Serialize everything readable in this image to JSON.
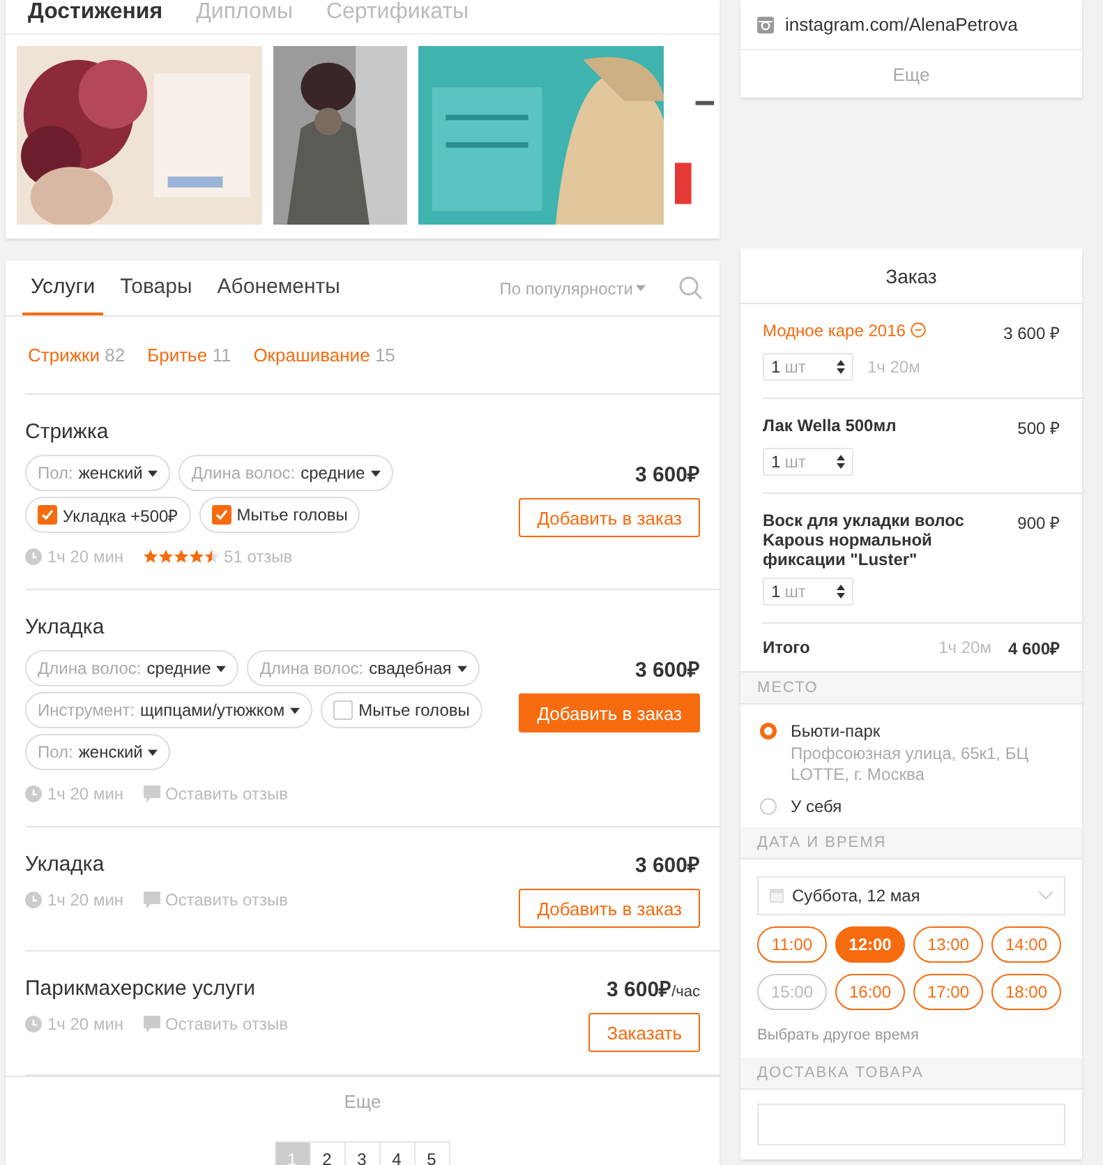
{
  "achievements": {
    "tabs": [
      {
        "label": "Достижения",
        "selected": true
      },
      {
        "label": "Дипломы",
        "selected": false
      },
      {
        "label": "Сертификаты",
        "selected": false
      }
    ]
  },
  "contacts": {
    "links": [
      {
        "text": "instagram.com/AlenaPetrova"
      }
    ],
    "more": "Еще"
  },
  "services": {
    "tabs": [
      {
        "label": "Услуги",
        "selected": true
      },
      {
        "label": "Товары",
        "selected": false
      },
      {
        "label": "Абонементы",
        "selected": false
      }
    ],
    "sort": "По популярности",
    "categories": [
      {
        "label": "Стрижки",
        "count": "82"
      },
      {
        "label": "Бритье",
        "count": "11"
      },
      {
        "label": "Окрашивание",
        "count": "15"
      }
    ],
    "items": [
      {
        "title": "Стрижка",
        "price": "3 600₽",
        "options": [
          {
            "kind": "select",
            "label": "Пол:",
            "value": "женский"
          },
          {
            "kind": "select",
            "label": "Длина волос:",
            "value": "средние"
          },
          {
            "kind": "checkbox",
            "label": "Укладка +500₽",
            "checked": true
          },
          {
            "kind": "checkbox",
            "label": "Мытье головы",
            "checked": true
          }
        ],
        "duration": "1ч 20 мин",
        "review": {
          "kind": "rating",
          "stars": 4.5,
          "text": "51 отзыв"
        },
        "button": "Добавить в заказ",
        "hovered": false
      },
      {
        "title": "Укладка",
        "price": "3 600₽",
        "options": [
          {
            "kind": "select",
            "label": "Длина волос:",
            "value": "средние"
          },
          {
            "kind": "select",
            "label": "Длина волос:",
            "value": "свадебная"
          },
          {
            "kind": "select",
            "label": "Инструмент:",
            "value": "щипцами/утюжком"
          },
          {
            "kind": "checkbox",
            "label": "Мытье головы",
            "checked": false
          },
          {
            "kind": "select",
            "label": "Пол:",
            "value": "женский"
          }
        ],
        "duration": "1ч 20 мин",
        "review": {
          "kind": "comment",
          "text": "Оставить отзыв"
        },
        "button": "Добавить в заказ",
        "hovered": true
      },
      {
        "title": "Укладка",
        "price": "3 600₽",
        "duration": "1ч 20 мин",
        "review": {
          "kind": "comment",
          "text": "Оставить отзыв"
        },
        "button": "Добавить в заказ",
        "hovered": false
      },
      {
        "title": "Парикмахерские услуги",
        "price": "3 600₽",
        "price_unit": "/час",
        "duration": "1ч 20 мин",
        "review": {
          "kind": "comment",
          "text": "Оставить отзыв"
        },
        "button": "Заказать",
        "hovered": false
      }
    ],
    "more": "Еще",
    "pages": [
      {
        "label": "1",
        "selected": true
      },
      {
        "label": "2",
        "selected": false
      },
      {
        "label": "3",
        "selected": false
      },
      {
        "label": "4",
        "selected": false
      },
      {
        "label": "5",
        "selected": false
      }
    ]
  },
  "order": {
    "title": "Заказ",
    "items": [
      {
        "kind": "service",
        "name": "Модное каре 2016",
        "price": "3 600 ₽",
        "qty": "1",
        "unit": "шт",
        "duration": "1ч 20м"
      },
      {
        "kind": "product",
        "name": "Лак Wella 500мл",
        "price": "500 ₽",
        "qty": "1",
        "unit": "шт"
      },
      {
        "kind": "product",
        "name": "Воск для укладки волос Kapous нормальной фиксации \"Luster\"",
        "price": "900 ₽",
        "qty": "1",
        "unit": "шт"
      }
    ],
    "total": {
      "label": "Итого",
      "duration": "1ч 20м",
      "sum": "4 600₽"
    },
    "place": {
      "header": "МЕСТО",
      "options": [
        {
          "name": "Бьюти-парк",
          "address": "Профсоюзная улица, 65к1, БЦ LOTTE, г. Москва",
          "selected": true
        },
        {
          "name": "У себя",
          "selected": false
        }
      ]
    },
    "datetime": {
      "header": "ДАТА И ВРЕМЯ",
      "date": "Суббота, 12 мая",
      "slots": [
        {
          "time": "11:00",
          "selected": false,
          "disabled": false
        },
        {
          "time": "12:00",
          "selected": true,
          "disabled": false
        },
        {
          "time": "13:00",
          "selected": false,
          "disabled": false
        },
        {
          "time": "14:00",
          "selected": false,
          "disabled": false
        },
        {
          "time": "15:00",
          "selected": false,
          "disabled": true
        },
        {
          "time": "16:00",
          "selected": false,
          "disabled": false
        },
        {
          "time": "17:00",
          "selected": false,
          "disabled": false
        },
        {
          "time": "18:00",
          "selected": false,
          "disabled": false
        }
      ],
      "other": "Выбрать другое время"
    },
    "delivery": {
      "header": "ДОСТАВКА ТОВАРА"
    }
  }
}
